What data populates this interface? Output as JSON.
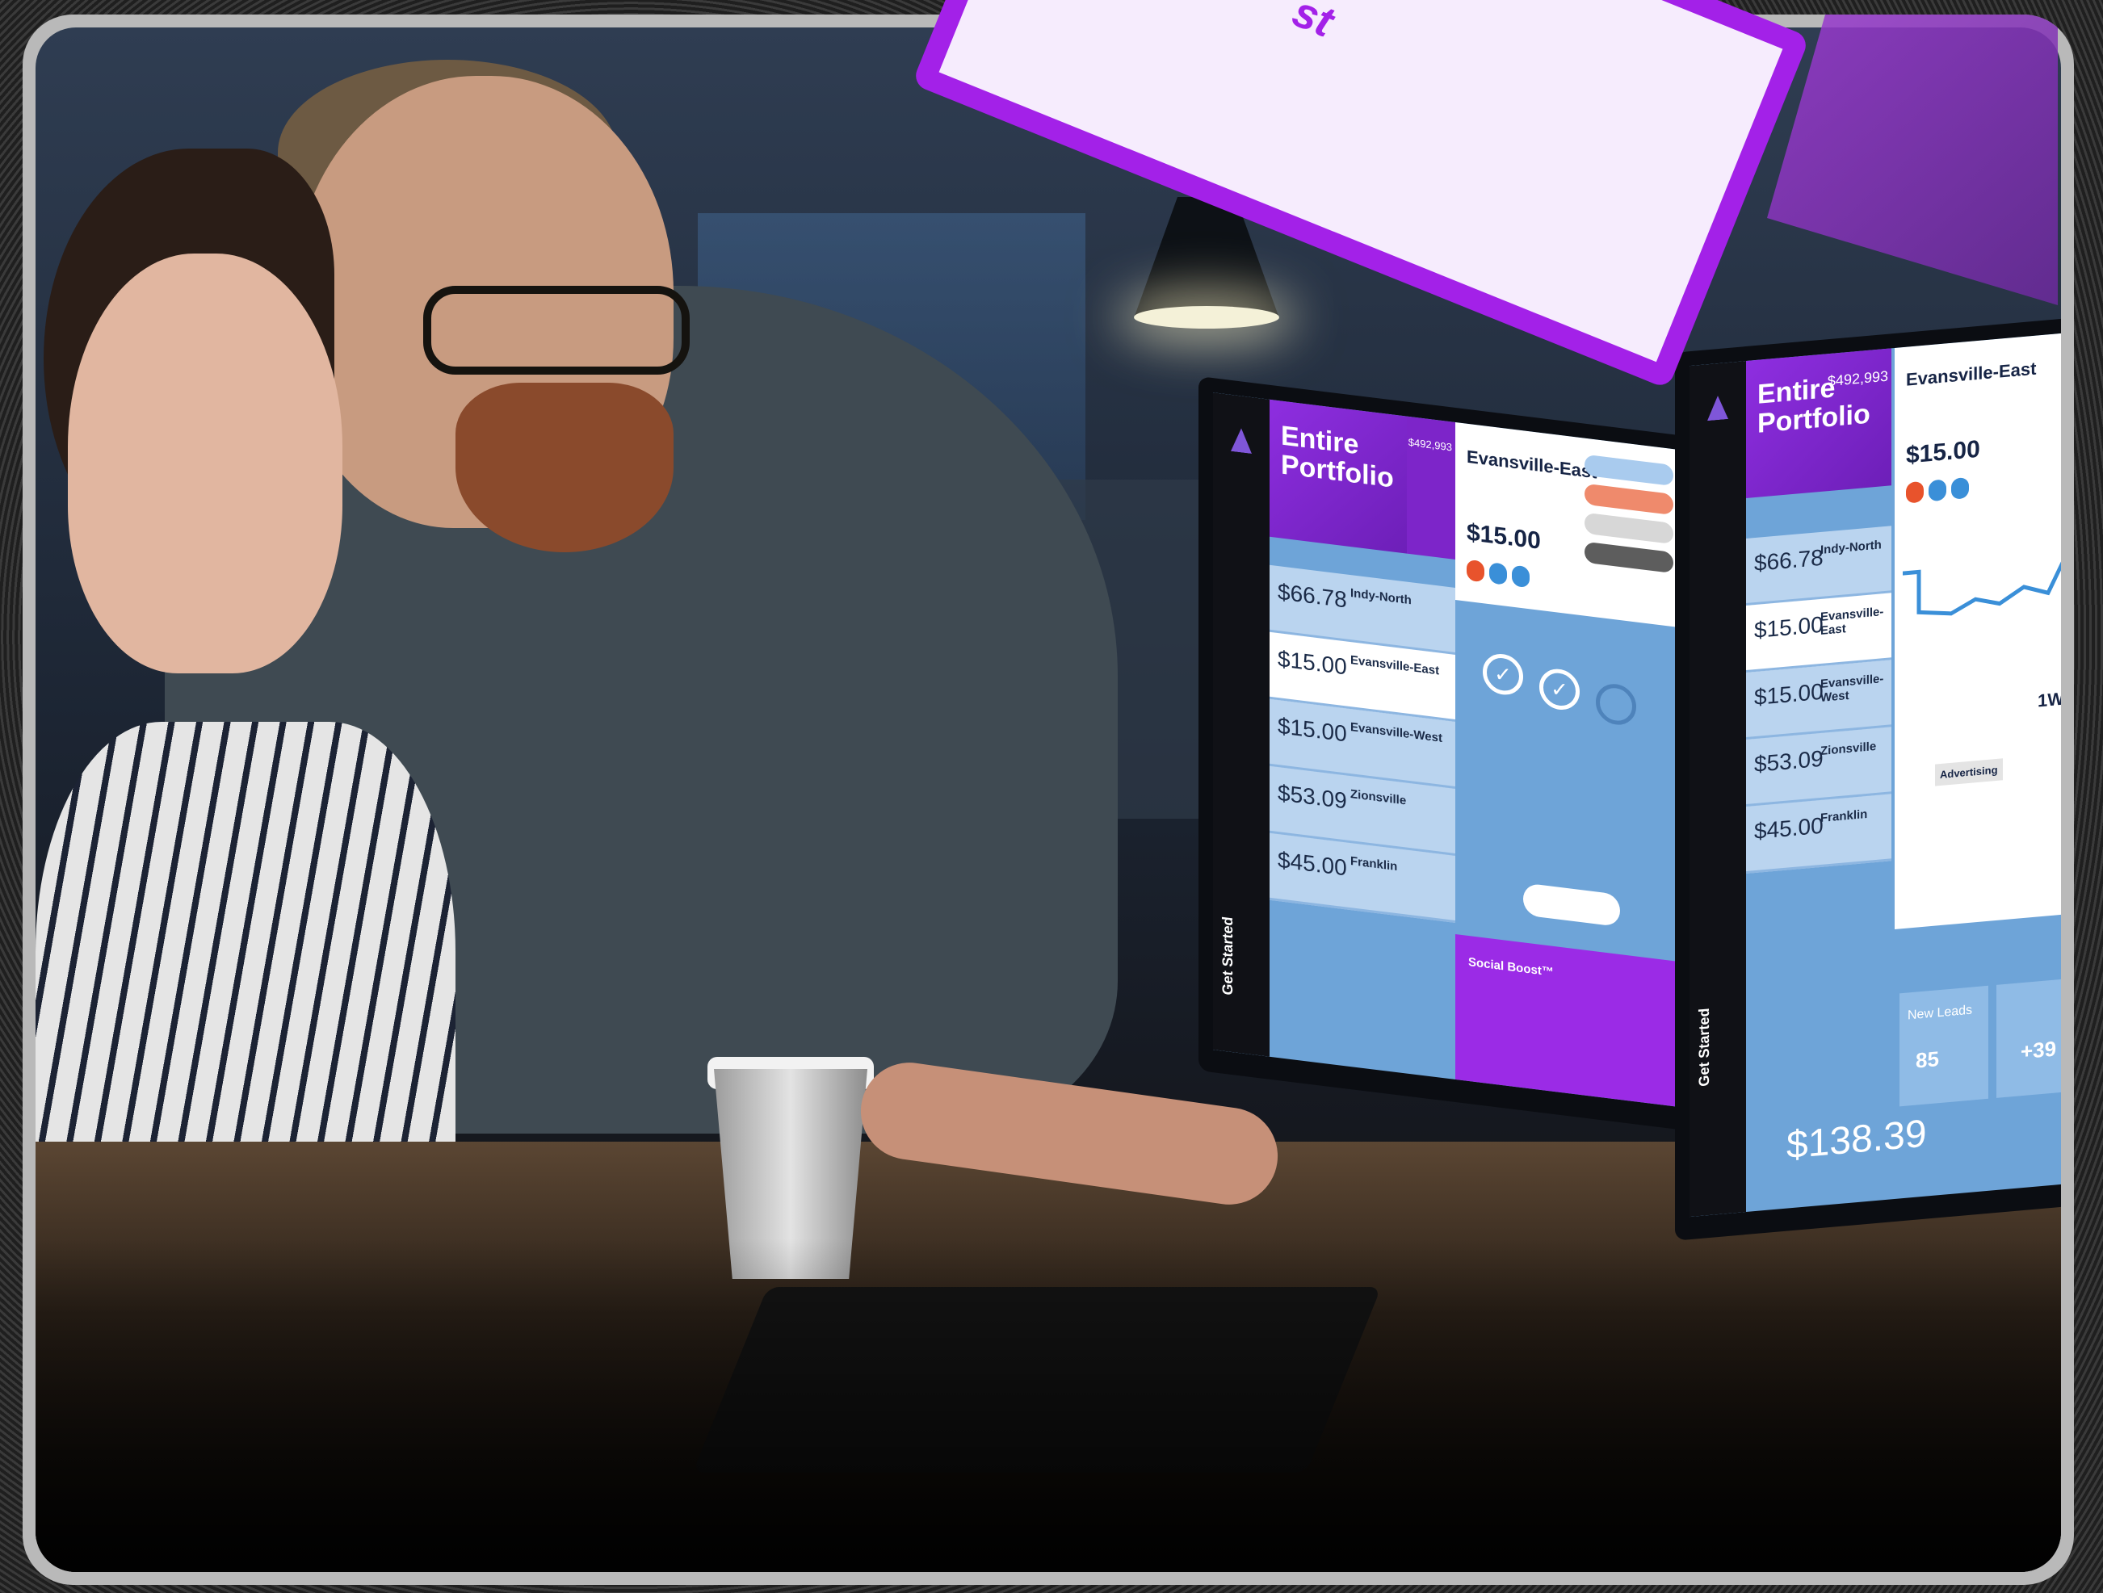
{
  "card": {
    "word": "st"
  },
  "monitor_left": {
    "hero_title": "Entire Portfolio",
    "hero_stat": "$492,993",
    "items": [
      {
        "price": "$66.78",
        "name": "Indy-North"
      },
      {
        "price": "$15.00",
        "name": "Evansville-East"
      },
      {
        "price": "$15.00",
        "name": "Evansville-West"
      },
      {
        "price": "$53.09",
        "name": "Zionsville"
      },
      {
        "price": "$45.00",
        "name": "Franklin"
      }
    ],
    "detail_title": "Evansville-East",
    "detail_price": "$15.00",
    "promo_title": "Social Boost™",
    "get_started": "Get Started"
  },
  "monitor_right": {
    "hero_title": "Entire Portfolio",
    "hero_stat": "$492,993",
    "items": [
      {
        "price": "$66.78",
        "name": "Indy-North"
      },
      {
        "price": "$15.00",
        "name": "Evansville-East"
      },
      {
        "price": "$15.00",
        "name": "Evansville-West"
      },
      {
        "price": "$53.09",
        "name": "Zionsville"
      },
      {
        "price": "$45.00",
        "name": "Franklin"
      }
    ],
    "detail_title": "Evansville-East",
    "detail_price": "$15.00",
    "range_label": "1W",
    "tab_advertising": "Advertising",
    "new_leads_label": "New Leads",
    "new_leads_value": "85",
    "conversions_value": "+39",
    "total": "$138.39",
    "get_started": "Get Started"
  },
  "colors": {
    "brand_purple": "#9b2be6",
    "screen_blue": "#6ea4d8",
    "frame_gray": "#b9b9b9"
  }
}
